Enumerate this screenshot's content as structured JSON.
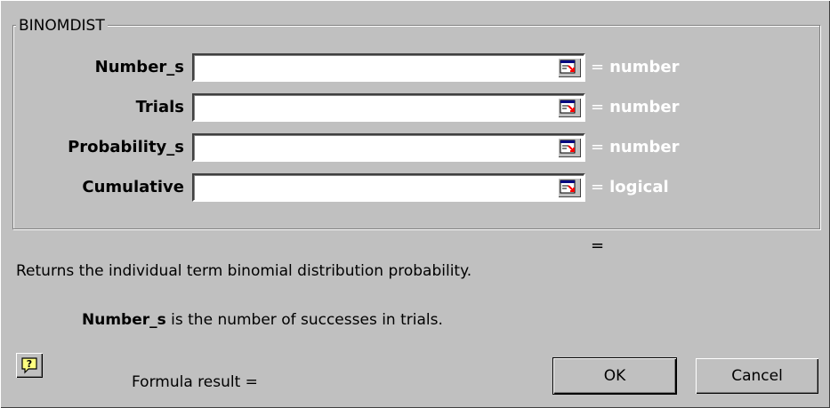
{
  "dialog": {
    "group_title": "BINOMDIST",
    "arguments": [
      {
        "label": "Number_s",
        "value": "",
        "eq": "=",
        "type": "number"
      },
      {
        "label": "Trials",
        "value": "",
        "eq": "=",
        "type": "number"
      },
      {
        "label": "Probability_s",
        "value": "",
        "eq": "=",
        "type": "number"
      },
      {
        "label": "Cumulative",
        "value": "",
        "eq": "=",
        "type": "logical"
      }
    ],
    "result_eq": "=",
    "description": "Returns the individual term binomial distribution probability.",
    "arg_help_name": "Number_s",
    "arg_help_text": " is the number of successes in trials.",
    "help_glyph": "?",
    "formula_result": "Formula result =",
    "ok_label": "OK",
    "cancel_label": "Cancel"
  },
  "icons": {
    "collapse": "collapse-dialog-icon",
    "help": "help-icon"
  },
  "colors": {
    "face": "#c0c0c0",
    "hint_text": "#ffffff",
    "collapse_arrow": "#ff0000",
    "collapse_bar": "#000080"
  }
}
